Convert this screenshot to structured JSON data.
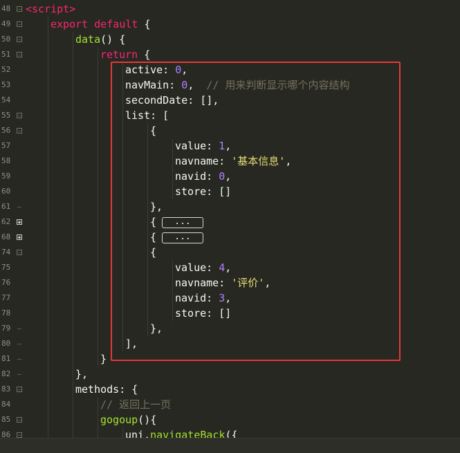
{
  "colors": {
    "background": "#272822",
    "keyword": "#f92672",
    "function": "#a6e22e",
    "number": "#ae81ff",
    "string": "#e6db74",
    "comment": "#75715e",
    "plain": "#f8f8f2",
    "highlight_box": "#e53935"
  },
  "lines": [
    {
      "number": "48",
      "fold": "expanded",
      "indent": 0,
      "tokens": [
        {
          "t": "tag",
          "v": "<script>"
        }
      ]
    },
    {
      "number": "49",
      "fold": "expanded",
      "indent": 1,
      "tokens": [
        {
          "t": "keyword",
          "v": "export default"
        },
        {
          "t": "plain",
          "v": " {"
        }
      ]
    },
    {
      "number": "50",
      "fold": "expanded",
      "indent": 2,
      "tokens": [
        {
          "t": "func",
          "v": "data"
        },
        {
          "t": "plain",
          "v": "() {"
        }
      ]
    },
    {
      "number": "51",
      "fold": "expanded",
      "indent": 3,
      "tokens": [
        {
          "t": "keyword",
          "v": "return"
        },
        {
          "t": "plain",
          "v": " {"
        }
      ]
    },
    {
      "number": "52",
      "fold": "none",
      "indent": 4,
      "tokens": [
        {
          "t": "plain",
          "v": "active: "
        },
        {
          "t": "number",
          "v": "0"
        },
        {
          "t": "plain",
          "v": ","
        }
      ]
    },
    {
      "number": "53",
      "fold": "none",
      "indent": 4,
      "tokens": [
        {
          "t": "plain",
          "v": "navMain: "
        },
        {
          "t": "number",
          "v": "0"
        },
        {
          "t": "plain",
          "v": ",  "
        },
        {
          "t": "comment",
          "v": "// 用来判断显示哪个内容结构"
        }
      ]
    },
    {
      "number": "54",
      "fold": "none",
      "indent": 4,
      "tokens": [
        {
          "t": "plain",
          "v": "secondDate: [],"
        }
      ]
    },
    {
      "number": "55",
      "fold": "expanded",
      "indent": 4,
      "tokens": [
        {
          "t": "plain",
          "v": "list: ["
        }
      ]
    },
    {
      "number": "56",
      "fold": "expanded",
      "indent": 5,
      "tokens": [
        {
          "t": "plain",
          "v": "{"
        }
      ]
    },
    {
      "number": "57",
      "fold": "none",
      "indent": 6,
      "tokens": [
        {
          "t": "plain",
          "v": "value: "
        },
        {
          "t": "number",
          "v": "1"
        },
        {
          "t": "plain",
          "v": ","
        }
      ]
    },
    {
      "number": "58",
      "fold": "none",
      "indent": 6,
      "tokens": [
        {
          "t": "plain",
          "v": "navname: "
        },
        {
          "t": "string",
          "v": "'基本信息'"
        },
        {
          "t": "plain",
          "v": ","
        }
      ]
    },
    {
      "number": "59",
      "fold": "none",
      "indent": 6,
      "tokens": [
        {
          "t": "plain",
          "v": "navid: "
        },
        {
          "t": "number",
          "v": "0"
        },
        {
          "t": "plain",
          "v": ","
        }
      ]
    },
    {
      "number": "60",
      "fold": "none",
      "indent": 6,
      "tokens": [
        {
          "t": "plain",
          "v": "store: []"
        }
      ]
    },
    {
      "number": "61",
      "fold": "end",
      "indent": 5,
      "tokens": [
        {
          "t": "plain",
          "v": "},"
        }
      ]
    },
    {
      "number": "62",
      "fold": "collapsed",
      "indent": 5,
      "tokens": [
        {
          "t": "plain",
          "v": "{"
        },
        {
          "t": "pill",
          "v": "..."
        }
      ]
    },
    {
      "number": "68",
      "fold": "collapsed",
      "indent": 5,
      "tokens": [
        {
          "t": "plain",
          "v": "{"
        },
        {
          "t": "pill",
          "v": "..."
        }
      ]
    },
    {
      "number": "74",
      "fold": "expanded",
      "indent": 5,
      "tokens": [
        {
          "t": "plain",
          "v": "{"
        }
      ]
    },
    {
      "number": "75",
      "fold": "none",
      "indent": 6,
      "tokens": [
        {
          "t": "plain",
          "v": "value: "
        },
        {
          "t": "number",
          "v": "4"
        },
        {
          "t": "plain",
          "v": ","
        }
      ]
    },
    {
      "number": "76",
      "fold": "none",
      "indent": 6,
      "tokens": [
        {
          "t": "plain",
          "v": "navname: "
        },
        {
          "t": "string",
          "v": "'评价'"
        },
        {
          "t": "plain",
          "v": ","
        }
      ]
    },
    {
      "number": "77",
      "fold": "none",
      "indent": 6,
      "tokens": [
        {
          "t": "plain",
          "v": "navid: "
        },
        {
          "t": "number",
          "v": "3"
        },
        {
          "t": "plain",
          "v": ","
        }
      ]
    },
    {
      "number": "78",
      "fold": "none",
      "indent": 6,
      "tokens": [
        {
          "t": "plain",
          "v": "store: []"
        }
      ]
    },
    {
      "number": "79",
      "fold": "end",
      "indent": 5,
      "tokens": [
        {
          "t": "plain",
          "v": "},"
        }
      ]
    },
    {
      "number": "80",
      "fold": "end",
      "indent": 4,
      "tokens": [
        {
          "t": "plain",
          "v": "],"
        }
      ]
    },
    {
      "number": "81",
      "fold": "end",
      "indent": 3,
      "tokens": [
        {
          "t": "plain",
          "v": "}"
        }
      ]
    },
    {
      "number": "82",
      "fold": "end",
      "indent": 2,
      "tokens": [
        {
          "t": "plain",
          "v": "},"
        }
      ]
    },
    {
      "number": "83",
      "fold": "expanded",
      "indent": 2,
      "tokens": [
        {
          "t": "plain",
          "v": "methods: {"
        }
      ]
    },
    {
      "number": "84",
      "fold": "none",
      "indent": 3,
      "tokens": [
        {
          "t": "comment",
          "v": "// 返回上一页"
        }
      ]
    },
    {
      "number": "85",
      "fold": "expanded",
      "indent": 3,
      "tokens": [
        {
          "t": "func",
          "v": "gogoup"
        },
        {
          "t": "plain",
          "v": "(){"
        }
      ]
    },
    {
      "number": "86",
      "fold": "expanded",
      "indent": 4,
      "tokens": [
        {
          "t": "plain",
          "v": "uni."
        },
        {
          "t": "func",
          "v": "navigateBack"
        },
        {
          "t": "plain",
          "v": "({"
        }
      ]
    }
  ]
}
